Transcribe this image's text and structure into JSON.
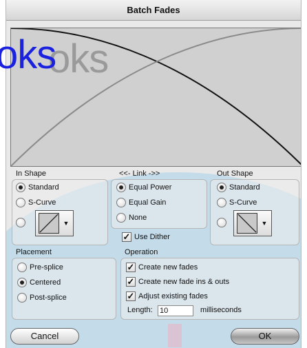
{
  "window": {
    "title": "Batch Fades"
  },
  "overlay_text": "oks",
  "in_shape": {
    "label": "In Shape",
    "options": [
      "Standard",
      "S-Curve"
    ],
    "selected": "Standard"
  },
  "link": {
    "label": "<<- Link ->>",
    "options": [
      "Equal Power",
      "Equal Gain",
      "None"
    ],
    "selected": "Equal Power",
    "use_dither_label": "Use Dither",
    "use_dither_checked": true
  },
  "out_shape": {
    "label": "Out Shape",
    "options": [
      "Standard",
      "S-Curve"
    ],
    "selected": "Standard"
  },
  "placement": {
    "label": "Placement",
    "options": [
      "Pre-splice",
      "Centered",
      "Post-splice"
    ],
    "selected": "Centered"
  },
  "operation": {
    "label": "Operation",
    "options": [
      "Create new fades",
      "Create new fade ins & outs",
      "Adjust existing fades"
    ],
    "checked": [
      true,
      true,
      true
    ],
    "length_label": "Length:",
    "length_value": "10",
    "length_unit": "milliseconds"
  },
  "buttons": {
    "cancel": "Cancel",
    "ok": "OK"
  },
  "icons": {
    "shape_dropdown_arrow": "triangle-down-icon",
    "fade_in_thumb": "fade-in-curve-icon",
    "fade_out_thumb": "fade-out-curve-icon"
  }
}
